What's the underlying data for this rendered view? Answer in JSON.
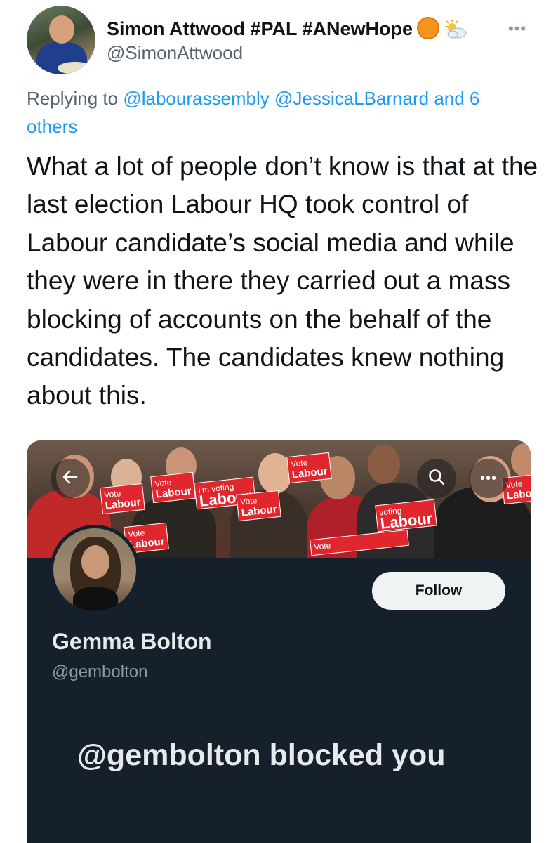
{
  "tweet": {
    "author_name": "Simon Attwood #PAL #ANewHope",
    "author_handle": "@SimonAttwood",
    "emoji_icons": [
      "orange-circle-icon",
      "sun-behind-cloud-icon"
    ],
    "more_icon": "more-icon",
    "replying_prefix": "Replying to",
    "reply_mentions": [
      "@labourassembly",
      "@JessicaLBarnard"
    ],
    "reply_others": "and 6 others",
    "text": "What a lot of people don’t know is that at the last election Labour HQ took control of Labour candidate’s social media and while they were in there they carried out a mass blocking of accounts on the behalf of the candidates. The candidates knew nothing about this."
  },
  "embedded_profile": {
    "banner_signs": [
      {
        "small": "Vote",
        "big": "Labour"
      },
      {
        "small": "Vote",
        "big": "Labour"
      },
      {
        "small": "Vote",
        "big": "Labour"
      },
      {
        "small": "I'm voting",
        "big": "Labour"
      },
      {
        "small": "Vote",
        "big": "Labour"
      },
      {
        "small": "Vote",
        "big": "Labour"
      },
      {
        "small": "voting",
        "big": "Labour"
      },
      {
        "small": "Vote",
        "big": "Labour"
      },
      {
        "small": "Vote",
        "big": ""
      }
    ],
    "back_icon": "arrow-left-icon",
    "search_icon": "search-icon",
    "more_icon": "more-icon",
    "follow_label": "Follow",
    "name": "Gemma Bolton",
    "handle": "@gembolton",
    "blocked_message": "@gembolton blocked you"
  },
  "colors": {
    "link": "#1d9bf0",
    "card_background": "#15202b",
    "banner_red": "#e2262e"
  }
}
